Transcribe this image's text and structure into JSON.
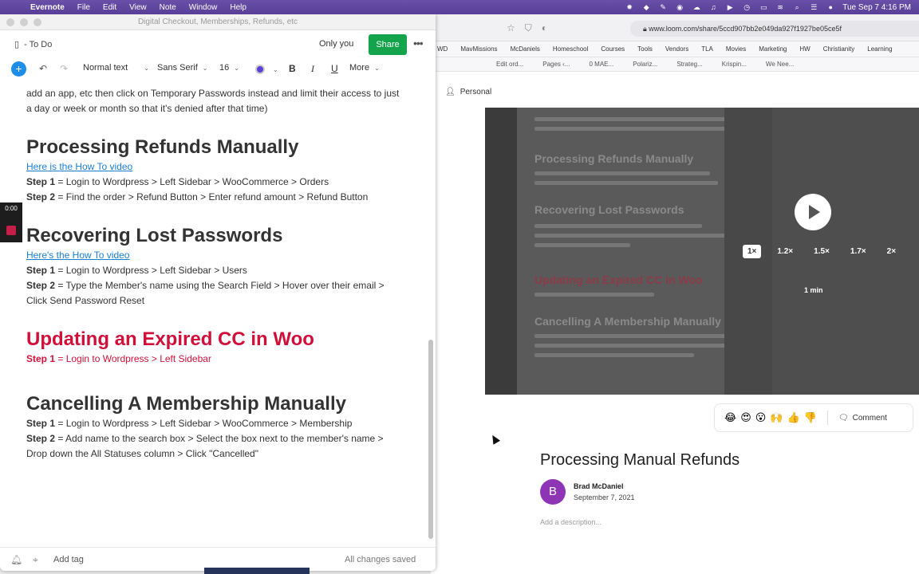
{
  "menubar": {
    "app": "Evernote",
    "items": [
      "File",
      "Edit",
      "View",
      "Note",
      "Window",
      "Help"
    ],
    "clock": "Tue Sep 7  4:16 PM"
  },
  "evernote": {
    "window_title": "Digital Checkout, Memberships, Refunds, etc",
    "notebook": "- To Do",
    "sharing": "Only you",
    "share_label": "Share",
    "toolbar": {
      "style": "Normal text",
      "font": "Sans Serif",
      "size": "16",
      "bold": "B",
      "italic": "I",
      "underline": "U",
      "more": "More"
    },
    "intro_text": "add an app, etc then click on Temporary Passwords instead and limit their access to just a day or week or month so that it's denied after that time)",
    "sections": [
      {
        "heading": "Processing Refunds Manually",
        "link": "Here is the How To video",
        "steps": [
          {
            "label": "Step 1",
            "text": " = Login to Wordpress > Left Sidebar > WooCommerce > Orders"
          },
          {
            "label": "Step 2",
            "text": " = Find the order > Refund Button > Enter refund amount > Refund Button"
          }
        ]
      },
      {
        "heading": "Recovering Lost Passwords",
        "link": "Here's the How To video",
        "steps": [
          {
            "label": "Step 1",
            "text": " = Login to Wordpress > Left Sidebar > Users"
          },
          {
            "label": "Step 2",
            "text": " = Type the Member's name using the Search Field > Hover over their email > Click Send Password Reset"
          }
        ]
      },
      {
        "heading": "Updating an Expired CC in Woo",
        "steps": [
          {
            "label": "Step 1",
            "text": " = Login to Wordpress > Left Sidebar"
          }
        ]
      },
      {
        "heading": "Cancelling A Membership Manually",
        "steps": [
          {
            "label": "Step 1",
            "text": " = Login to Wordpress > Left Sidebar > WooCommerce > Membership"
          },
          {
            "label": "Step 2",
            "text": " = Add name to the search box > Select the box next to the member's name > Drop down the All Statuses column > Click \"Cancelled\""
          }
        ]
      }
    ],
    "footer": {
      "add_tag": "Add tag",
      "status": "All changes saved"
    }
  },
  "recorder": {
    "time": "0:00"
  },
  "browser": {
    "url": "www.loom.com/share/5ccd907bb2e049da927f1927be05ce5f",
    "bookmarks": [
      "WD",
      "MavMissions",
      "McDaniels",
      "Homeschool",
      "Courses",
      "Tools",
      "Vendors",
      "TLA",
      "Movies",
      "Marketing",
      "HW",
      "Christianity",
      "Learning"
    ],
    "tabs": [
      "Edit ord...",
      "Pages ‹...",
      "0 MAE...",
      "Polariz...",
      "Strateg...",
      "Krispin...",
      "We Nee..."
    ],
    "workspace": "Personal",
    "video": {
      "speeds": [
        "1×",
        "1.2×",
        "1.5×",
        "1.7×",
        "2×"
      ],
      "duration": "1 min"
    },
    "reactions": [
      "😂",
      "😍",
      "😮",
      "🙌",
      "👍",
      "👎"
    ],
    "comment_label": "Comment",
    "loom_title": "Processing Manual Refunds",
    "author": {
      "initial": "B",
      "name": "Brad McDaniel",
      "date": "September 7, 2021"
    },
    "description_placeholder": "Add a description..."
  }
}
